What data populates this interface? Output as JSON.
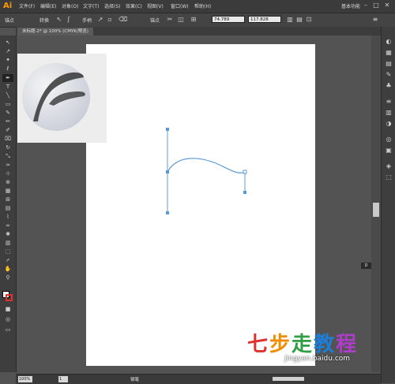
{
  "app": {
    "logo": "Ai"
  },
  "menubar": {
    "items": [
      "文件(F)",
      "编辑(E)",
      "对象(O)",
      "文字(T)",
      "选择(S)",
      "效果(C)",
      "视图(V)",
      "窗口(W)",
      "帮助(H)"
    ],
    "workspace": "基本功能"
  },
  "controlbar": {
    "mode_label": "锚点",
    "convert_label": "转换",
    "handle_label": "手柄",
    "anchor_label": "锚点",
    "x_value": "74.789",
    "y_value": "117.828"
  },
  "document": {
    "tab_title": "未标题-2* @ 100% (CMYK/预览)"
  },
  "status": {
    "zoom": "100%",
    "page": "1",
    "tool_text": "钢笔"
  },
  "canvas": {
    "indicator": "D"
  },
  "watermark": {
    "chars": [
      "七",
      "步",
      "走",
      "教",
      "程"
    ],
    "site": "jingyan.baidu.com"
  },
  "colors": {
    "fill": "#ffffff",
    "stroke": "#e03131",
    "path": "#5b9bd5"
  }
}
